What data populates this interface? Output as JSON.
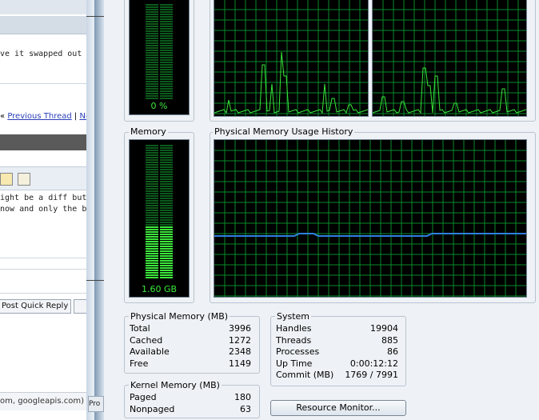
{
  "background_window": {
    "line1": "ve it swapped out b",
    "line2_prefix": "«",
    "prev_thread": "Previous Thread",
    "separator": "|",
    "next_fragment": "Ne",
    "text_line1": "ight be a diff but n",
    "text_line2": "now and only the b",
    "quick_reply": "Post Quick Reply",
    "status_text": "om, googleapis.com) | <",
    "pr_fragment": "Pro"
  },
  "cpu": {
    "usage_label": "0 %"
  },
  "memory": {
    "section_label": "Memory",
    "value": "1.60 GB",
    "usage_fraction": 0.4
  },
  "history": {
    "label": "Physical Memory Usage History"
  },
  "physical_memory": {
    "label": "Physical Memory (MB)",
    "rows": [
      {
        "key": "Total",
        "value": "3996"
      },
      {
        "key": "Cached",
        "value": "1272"
      },
      {
        "key": "Available",
        "value": "2348"
      },
      {
        "key": "Free",
        "value": "1149"
      }
    ]
  },
  "kernel_memory": {
    "label": "Kernel Memory (MB)",
    "rows": [
      {
        "key": "Paged",
        "value": "180"
      },
      {
        "key": "Nonpaged",
        "value": "63"
      }
    ]
  },
  "system": {
    "label": "System",
    "rows": [
      {
        "key": "Handles",
        "value": "19904"
      },
      {
        "key": "Threads",
        "value": "885"
      },
      {
        "key": "Processes",
        "value": "86"
      },
      {
        "key": "Up Time",
        "value": "0:00:12:12"
      },
      {
        "key": "Commit (MB)",
        "value": "1769 / 7991"
      }
    ]
  },
  "resource_monitor_button": "Resource Monitor...",
  "colors": {
    "graph_line": "#39e639",
    "grid": "#0a8a2a",
    "memory_line": "#2f7fe0",
    "background": "#eef2f6"
  }
}
